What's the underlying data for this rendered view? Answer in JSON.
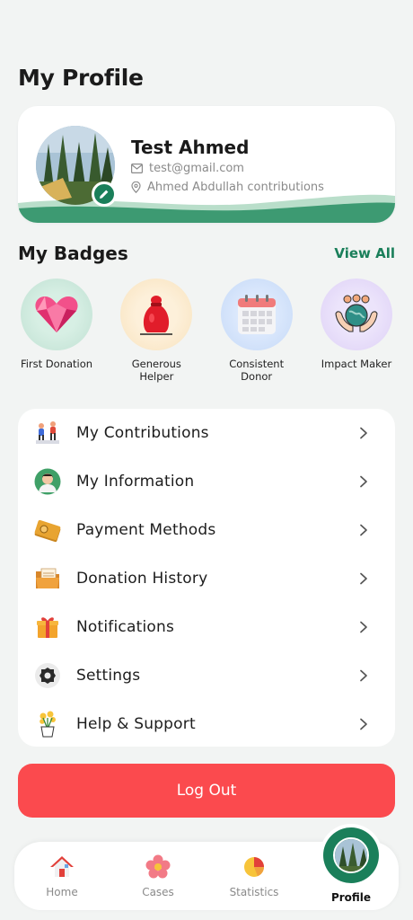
{
  "header": {
    "title": "My Profile"
  },
  "profile": {
    "name": "Test Ahmed",
    "email": "test@gmail.com",
    "location": "Ahmed Abdullah contributions"
  },
  "badges": {
    "title": "My Badges",
    "view_all": "View All",
    "items": [
      {
        "label": "First Donation",
        "icon": "heart-gem-icon",
        "bg": "#cfe8dd"
      },
      {
        "label": "Generous Helper",
        "icon": "money-bag-icon",
        "bg": "#fbe8c8"
      },
      {
        "label": "Consistent Donor",
        "icon": "calendar-icon",
        "bg": "#cfe0fa"
      },
      {
        "label": "Impact Maker",
        "icon": "globe-hands-icon",
        "bg": "#e6dcf8"
      }
    ]
  },
  "menu": {
    "items": [
      {
        "label": "My Contributions",
        "icon": "contributions-icon"
      },
      {
        "label": "My Information",
        "icon": "user-icon"
      },
      {
        "label": "Payment Methods",
        "icon": "wallet-icon"
      },
      {
        "label": "Donation History",
        "icon": "folder-icon"
      },
      {
        "label": "Notifications",
        "icon": "gift-icon"
      },
      {
        "label": "Settings",
        "icon": "gear-icon"
      },
      {
        "label": "Help & Support",
        "icon": "flower-pot-icon"
      }
    ]
  },
  "logout": {
    "label": "Log Out"
  },
  "nav": {
    "items": [
      {
        "label": "Home",
        "icon": "home-icon"
      },
      {
        "label": "Cases",
        "icon": "flower-icon"
      },
      {
        "label": "Statistics",
        "icon": "pie-chart-icon"
      },
      {
        "label": "Profile",
        "icon": "avatar-icon",
        "active": true
      }
    ]
  },
  "colors": {
    "accent": "#1a7f5a",
    "danger": "#fb4a4e",
    "background": "#f2f4f3"
  }
}
